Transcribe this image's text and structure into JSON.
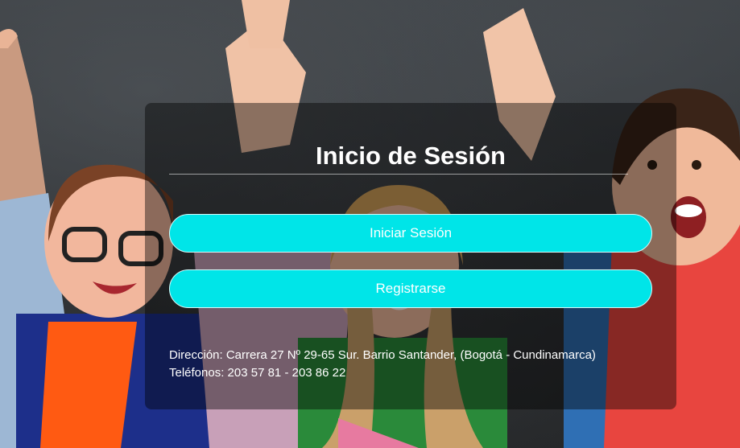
{
  "background": {
    "description_icon": "kids-chalkboard-photo",
    "board_color": "#2e3134"
  },
  "login_card": {
    "title": "Inicio de Sesión",
    "login_button_label": "Iniciar Sesión",
    "register_button_label": "Registrarse",
    "accent_color": "#00e5e8",
    "address": "Dirección: Carrera 27 Nº 29-65 Sur. Barrio Santander, (Bogotá - Cundinamarca)",
    "phones": "Teléfonos: 203 57 81 - 203 86 22"
  }
}
